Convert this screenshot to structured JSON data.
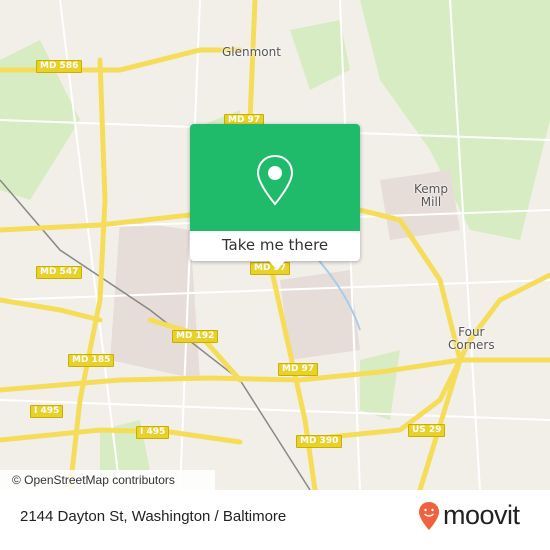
{
  "map": {
    "places": [
      "Glenmont",
      "Kemp\nMill",
      "Four\nCorners"
    ],
    "shields": [
      "MD 586",
      "MD 97",
      "MD 547",
      "MD 192",
      "MD 185",
      "MD 97",
      "I 495",
      "I 495",
      "MD 390",
      "US 29",
      "MD 97"
    ],
    "attribution": "© OpenStreetMap contributors",
    "colors": {
      "land": "#f2efe9",
      "park": "#d8ecc4",
      "road_major": "#f5dd5a",
      "road_minor": "#ffffff",
      "water": "#a9cde8"
    }
  },
  "popup": {
    "icon": "location-pin-icon",
    "button_label": "Take me there",
    "color": "#1fba6a"
  },
  "footer": {
    "address": "2144 Dayton St, Washington / Baltimore",
    "brand": "moovit",
    "brand_color": "#f0623e"
  }
}
